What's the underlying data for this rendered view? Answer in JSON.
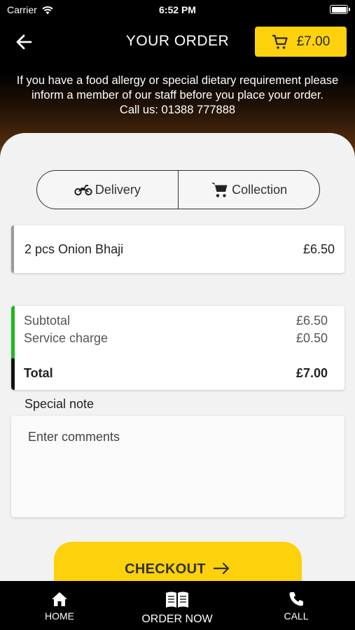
{
  "status_bar": {
    "carrier": "Carrier",
    "time": "6:52 PM"
  },
  "header": {
    "title": "YOUR ORDER",
    "cart_total": "£7.00"
  },
  "notice": {
    "text": "If you have a food allergy or special dietary requirement please inform a member of our staff before you place your order.",
    "call": "Call us: 01388 777888"
  },
  "order_type": {
    "delivery_label": "Delivery",
    "collection_label": "Collection"
  },
  "items": [
    {
      "name": "2 pcs Onion Bhaji",
      "price": "£6.50"
    }
  ],
  "totals": {
    "subtotal_label": "Subtotal",
    "subtotal": "£6.50",
    "service_label": "Service charge",
    "service": "£0.50",
    "total_label": "Total",
    "total": "£7.00"
  },
  "note": {
    "label": "Special note",
    "placeholder": "Enter comments"
  },
  "checkout": {
    "label": "CHECKOUT"
  },
  "tabs": {
    "home": "HOME",
    "order_now": "ORDER NOW",
    "call": "CALL"
  },
  "colors": {
    "accent": "#fdd10b",
    "subtotal_bar": "#1fb91f",
    "item_bar": "#9a9a9a"
  }
}
